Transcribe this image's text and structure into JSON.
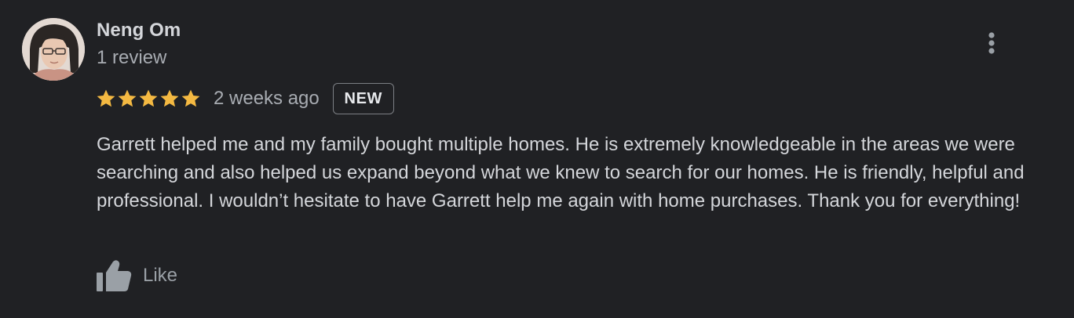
{
  "review": {
    "author": {
      "name": "Neng Om",
      "review_count": "1 review",
      "avatar_icon": "user-avatar-photo"
    },
    "rating": {
      "stars": 5,
      "max_stars": 5,
      "star_color": "#f4b942"
    },
    "time_ago": "2 weeks ago",
    "badge": "NEW",
    "text": "Garrett helped me and my family bought multiple homes. He is extremely knowledgeable in the areas we were searching and also helped us expand beyond what we knew to search for our homes. He is friendly, helpful and professional. I wouldn’t hesitate to have Garrett help me again with home purchases. Thank you for everything!",
    "actions": {
      "like_label": "Like",
      "like_icon": "thumbs-up-icon",
      "more_icon": "more-vert-icon"
    }
  },
  "colors": {
    "background": "#202124",
    "primary_text": "#d4d6da",
    "secondary_text": "#a8acb2",
    "icon_gray": "#9aa0a6"
  }
}
